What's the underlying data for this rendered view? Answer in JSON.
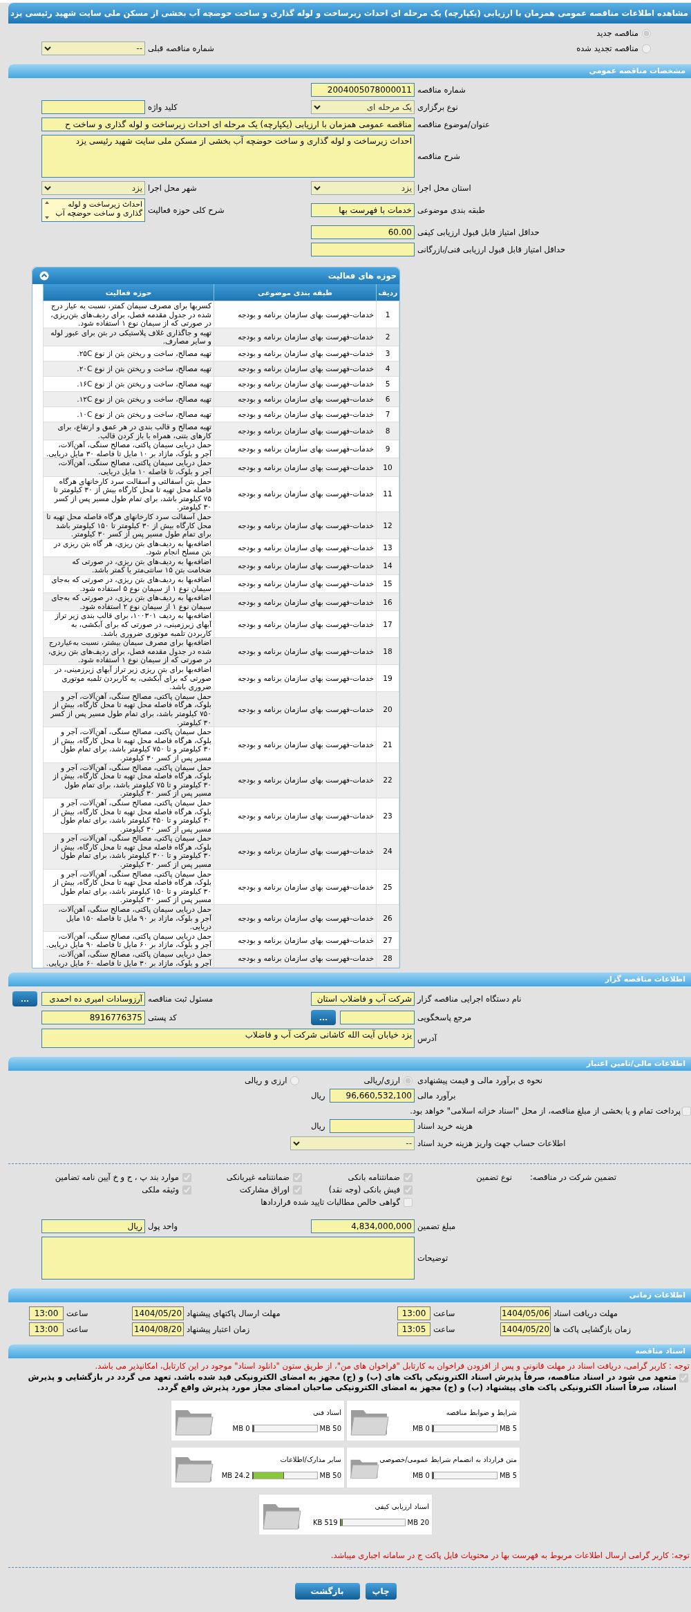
{
  "page_title": "مشاهده اطلاعات مناقصه عمومی همزمان با ارزیابی (یکپارچه) یک مرحله ای احداث زیرساخت و لوله گذاری و ساخت حوضچه آب بخشی از مسکن ملی سایت شهید رئیسی یزد",
  "tender_type": {
    "options": [
      {
        "label": "مناقصه جدید",
        "selected": true
      },
      {
        "label": "مناقصه تجدید شده",
        "selected": false
      }
    ],
    "previous": {
      "label": "شماره مناقصه قبلی",
      "value": "--"
    }
  },
  "general": {
    "title": "مشخصات مناقصه عمومی",
    "rows": [
      [
        {
          "label": "شماره مناقصه",
          "value": "2004005078000011",
          "kind": "input"
        }
      ],
      [
        {
          "label": "نوع برگزاری",
          "value": "یک مرحله ای",
          "kind": "select"
        },
        {
          "label": "کلید واژه",
          "kind": "input"
        }
      ],
      [
        {
          "label": "عنوان/موضوع مناقصه",
          "value": "مناقصه عمومی همزمان با ارزیابی (یکپارچه) یک مرحله ای احداث زیرساخت و لوله گذاری و ساخت ح",
          "kind": "wide-input"
        }
      ],
      [
        {
          "label": "شرح مناقصه",
          "value": "احداث زیرساخت و لوله گذاری و ساخت حوضچه آب بخشی از مسکن ملی سایت شهید رئیسی یزد",
          "kind": "textarea"
        }
      ],
      [
        {
          "label": "استان محل اجرا",
          "value": "یزد",
          "kind": "select"
        },
        {
          "label": "شهر محل اجرا",
          "value": "یزد",
          "kind": "select"
        }
      ],
      [
        {
          "label": "طبقه بندی موضوعی",
          "value": "خدمات با فهرست بها",
          "kind": "input"
        },
        {
          "label": "شرح کلی حوزه فعالیت",
          "value": "احداث زیرساخت و لوله گذاری و ساخت حوضچه آب",
          "kind": "listbox"
        }
      ],
      [
        {
          "label": "حداقل امتیاز قابل قبول ارزیابی کیفی",
          "value": "60.00",
          "kind": "input"
        }
      ],
      [
        {
          "label": "حداقل امتیاز قابل قبول ارزیابی فنی/بازرگانی",
          "kind": "input"
        }
      ]
    ]
  },
  "activities": {
    "title": "حوزه های فعالیت",
    "columns": [
      "ردیف",
      "طبقه بندی موضوعی",
      "حوزه فعالیت"
    ],
    "rows": [
      {
        "index": "1",
        "category": "خدمات-فهرست بهای سازمان برنامه و بودجه",
        "activity": "کسربها برای مصرف سیمان کمتر، نسبت به عیار درج شده در جدول مقدمه فصل، برای ردیف‌های بتن‌ریزی، در صورتی که از سیمان نوع ۱ استفاده شود."
      },
      {
        "index": "2",
        "category": "خدمات-فهرست بهای سازمان برنامه و بودجه",
        "activity": "تهیه و جاگذاری غلاف پلاستیکی در بتن برای عبور لوله و سایر مصارف."
      },
      {
        "index": "3",
        "category": "خدمات-فهرست بهای سازمان برنامه و بودجه",
        "activity": "تهیه مصالح، ساخت و ریختن بتن از نوع ۲۵C."
      },
      {
        "index": "4",
        "category": "خدمات-فهرست بهای سازمان برنامه و بودجه",
        "activity": "تهیه مصالح، ساخت و ریختن بتن از نوع ۲۰C."
      },
      {
        "index": "5",
        "category": "خدمات-فهرست بهای سازمان برنامه و بودجه",
        "activity": "تهیه مصالح، ساخت و ریختن بتن از نوع ۱۶C."
      },
      {
        "index": "6",
        "category": "خدمات-فهرست بهای سازمان برنامه و بودجه",
        "activity": "تهیه مصالح، ساخت و ریختن بتن از نوع ۱۲C."
      },
      {
        "index": "7",
        "category": "خدمات-فهرست بهای سازمان برنامه و بودجه",
        "activity": "تهیه مصالح، ساخت و ریختن بتن از نوع ۱۰C."
      },
      {
        "index": "8",
        "category": "خدمات-فهرست بهای سازمان برنامه و بودجه",
        "activity": "تهیه مصالح و قالب بندی در هر عمق و ارتفاع، برای کارهای بتنی، همراه با باز کردن قالب."
      },
      {
        "index": "9",
        "category": "خدمات-فهرست بهای سازمان برنامه و بودجه",
        "activity": "حمل دریایی سیمان پاکتی، مصالح سنگی، آهن‌آلات، آجر و بلوک، مازاد بر ۱۰ مایل تا فاصله ۳۰ مایل دریایی."
      },
      {
        "index": "10",
        "category": "خدمات-فهرست بهای سازمان برنامه و بودجه",
        "activity": "حمل دریایی سیمان پاکتی، مصالح سنگی، آهن‌آلات، آجر و بلوک، تا فاصله ۱۰ مایل دریایی."
      },
      {
        "index": "11",
        "category": "خدمات-فهرست بهای سازمان برنامه و بودجه",
        "activity": "حمل بتن آسفالتی و آسفالت سرد کارخانهای هرگاه فاصله محل تهیه تا محل کارگاه بیش از ۳۰ کیلومتر تا ۷۵ کیلومتر باشد، برای تمام طول مسیر پس از کسر ۳۰ کیلومتر."
      },
      {
        "index": "12",
        "category": "خدمات-فهرست بهای سازمان برنامه و بودجه",
        "activity": "حمل آسفالت سرد کارخانهای هرگاه فاصله محل تهیه تا محل کارگاه بیش از ۳۰ کیلومتر تا ۱۵۰ کیلومتر باشد برای تمام طول مسیر پس از کسر ۳۰ کیلومتر."
      },
      {
        "index": "13",
        "category": "خدمات-فهرست بهای سازمان برنامه و بودجه",
        "activity": "اضافه‌بها به ردیف‌های بتن ریزی، هر گاه بتن ریزی در بتن مسلح انجام شود."
      },
      {
        "index": "14",
        "category": "خدمات-فهرست بهای سازمان برنامه و بودجه",
        "activity": "اضافه‌بها به ردیف‌های بتن ریزی، در صورتی که ضخامت بتن ۱۵ سانتی‌متر یا کمتر باشد."
      },
      {
        "index": "15",
        "category": "خدمات-فهرست بهای سازمان برنامه و بودجه",
        "activity": "اضافه‌بها به ردیف‌های بتن ریزی، در صورتی که به‌جای سیمان نوع ۱ از سیمان نوع ۵ استفاده شود."
      },
      {
        "index": "16",
        "category": "خدمات-فهرست بهای سازمان برنامه و بودجه",
        "activity": "اضافه‌بها به ردیف‌های بتن ریزی، در صورتی که به‌جای سیمان نوع ۱ از سیمان نوع ۲ استفاده شود."
      },
      {
        "index": "17",
        "category": "خدمات-فهرست بهای سازمان برنامه و بودجه",
        "activity": "اضافه‌بها به ردیف ۱۰۰۳۰۱، برای قالب بندی زیر تراز آبهای زیرزمینی، در صورتی که برای آبکشی، به کاربردن تلمبه موتوری ضروری باشد."
      },
      {
        "index": "18",
        "category": "خدمات-فهرست بهای سازمان برنامه و بودجه",
        "activity": "اضافه‌بها برای مصرف سیمان بیشتر، نسبت به‌عیاردرج شده در جدول مقدمه فصل، برای ردیف‌های بتن ریزی، در صورتی که از سیمان نوع ۱ استفاده شود."
      },
      {
        "index": "19",
        "category": "خدمات-فهرست بهای سازمان برنامه و بودجه",
        "activity": "اضافه‌بها برای بتن ریزی زیر تراز آبهای زیرزمینی، در صورتی که برای آبکشی، به کاربردن تلمبه موتوری ضروری باشد."
      },
      {
        "index": "20",
        "category": "خدمات-فهرست بهای سازمان برنامه و بودجه",
        "activity": "حمل سیمان پاکتی، مصالح سنگی، آهن‌آلات، آجر و بلوک، هرگاه فاصله محل تهیه تا محل کارگاه، بیش از ۷۵۰ کیلومتر باشد، برای تمام طول مسیر پس از کسر ۳۰ کیلومتر."
      },
      {
        "index": "21",
        "category": "خدمات-فهرست بهای سازمان برنامه و بودجه",
        "activity": "حمل سیمان پاکتی، مصالح سنگی، آهن‌آلات، آجر و بلوک، هرگاه فاصله محل تهیه تا محل کارگاه، بیش از ۳۰ کیلومتر و تا ۷۵۰ کیلومتر باشد، برای تمام طول مسیر پس از کسر ۳۰ کیلومتر."
      },
      {
        "index": "22",
        "category": "خدمات-فهرست بهای سازمان برنامه و بودجه",
        "activity": "حمل سیمان پاکتی، مصالح سنگی، آهن‌آلات، آجر و بلوک، هرگاه فاصله محل تهیه تا محل کارگاه، بیش از ۳۰ کیلومتر و تا ۷۵ کیلومتر باشد، برای تمام طول مسیر پس از کسر ۳۰ کیلومتر."
      },
      {
        "index": "23",
        "category": "خدمات-فهرست بهای سازمان برنامه و بودجه",
        "activity": "حمل سیمان پاکتی، مصالح سنگی، آهن‌آلات، آجر و بلوک، هرگاه فاصله محل تهیه تا محل کارگاه، بیش از ۳۰ کیلومتر و تا ۴۵۰ کیلومتر باشد، برای تمام طول مسیر پس از کسر ۳۰ کیلومتر."
      },
      {
        "index": "24",
        "category": "خدمات-فهرست بهای سازمان برنامه و بودجه",
        "activity": "حمل سیمان پاکتی، مصالح سنگی، آهن‌آلات، آجر و بلوک، هرگاه فاصله محل تهیه تا محل کارگاه، بیش از ۳۰ کیلومتر و تا ۳۰۰ کیلومتر باشد، برای تمام طول مسیر پس از کسر ۳۰ کیلومتر."
      },
      {
        "index": "25",
        "category": "خدمات-فهرست بهای سازمان برنامه و بودجه",
        "activity": "حمل سیمان پاکتی، مصالح سنگی، آهن‌آلات، آجر و بلوک، هرگاه فاصله محل تهیه تا محل کارگاه، بیش از ۳۰ کیلومتر و تا ۱۵۰ کیلومتر باشد، برای تمام طول مسیر پس از کسر ۳۰ کیلومتر."
      },
      {
        "index": "26",
        "category": "خدمات-فهرست بهای سازمان برنامه و بودجه",
        "activity": "حمل دریایی سیمان پاکتی، مصالح سنگی، آهن‌آلات، آجر و بلوک، مازاد بر ۹۰ مایل تا فاصله ۱۵۰ مایل دریایی."
      },
      {
        "index": "27",
        "category": "خدمات-فهرست بهای سازمان برنامه و بودجه",
        "activity": "حمل دریایی سیمان پاکتی، مصالح سنگی، آهن‌آلات، آجر و بلوک، مازاد بر ۶۰ مایل تا فاصله ۹۰ مایل دریایی."
      },
      {
        "index": "28",
        "category": "خدمات-فهرست بهای سازمان برنامه و بودجه",
        "activity": "حمل دریایی سیمان پاکتی، مصالح سنگی، آهن‌آلات، آجر و بلوک، مازاد بر ۳۰ مایل تا فاصله ۶۰ مایل دریایی."
      }
    ]
  },
  "organizer": {
    "title": "اطلاعات مناقصه گزار",
    "rows": [
      [
        {
          "label": "نام دستگاه اجرایی مناقصه گزار",
          "value": "شرکت آب و فاضلاب استان",
          "kind": "input"
        },
        {
          "label": "مسئول ثبت مناقصه",
          "value": "آرزوسادات امیری ده احمدی",
          "kind": "input",
          "button": "..."
        }
      ],
      [
        {
          "label": "مرجع پاسخگویی",
          "kind": "input",
          "button": "..."
        },
        {
          "label": "کد پستی",
          "value": "8916776375",
          "kind": "input"
        }
      ],
      [
        {
          "label": "آدرس",
          "value": "یزد خیابان آیت الله کاشانی شرکت آب و فاضلاب",
          "kind": "short-textarea"
        }
      ]
    ]
  },
  "financial": {
    "title": "اطلاعات مالی/تامین اعتبار",
    "estimate_method": {
      "label": "نحوه ی برآورد مالی و قیمت پیشنهادی",
      "options": [
        {
          "label": "ارزی/ریالی",
          "selected": true
        },
        {
          "label": "ارزی و ریالی",
          "selected": false
        }
      ]
    },
    "estimate": {
      "label": "برآورد مالی",
      "value": "96,660,532,100",
      "unit": "ریال"
    },
    "treasury": {
      "label": "پرداخت تمام و یا بخشی از مبلغ مناقصه، از محل \"اسناد خزانه اسلامی\" خواهد بود.",
      "checked": false
    },
    "document_fee": {
      "label": "هزینه خرید اسناد",
      "unit": "ریال"
    },
    "account": {
      "label": "اطلاعات حساب جهت واریز هزینه خرید اسناد",
      "value": "--"
    },
    "guarantee": {
      "label": "تضمین شرکت در مناقصه:",
      "type_label": "نوع تضمین",
      "options": [
        {
          "label": "ضمانتنامه بانکی",
          "checked": true
        },
        {
          "label": "ضمانتنامه غیربانکی",
          "checked": true
        },
        {
          "label": "موارد بند پ ، ح و خ آیین نامه تضامین",
          "checked": true
        },
        {
          "label": "فیش بانکی (وجه نقد)",
          "checked": true
        },
        {
          "label": "اوراق مشارکت",
          "checked": true
        },
        {
          "label": "وثیقه ملکی",
          "checked": true
        },
        {
          "label": "گواهی خالص مطالبات تایید شده قراردادها",
          "checked": false
        }
      ]
    },
    "amount": {
      "label": "مبلغ تضمین",
      "value": "4,834,000,000"
    },
    "currency": {
      "label": "واحد پول",
      "value": "ریال"
    },
    "notes": {
      "label": "توضیحات"
    }
  },
  "schedule": {
    "title": "اطلاعات زمانی",
    "rows": [
      [
        {
          "label": "مهلت دریافت اسناد",
          "date": "1404/05/06",
          "time_label": "ساعت",
          "time": "13:00"
        },
        {
          "label": "مهلت ارسال پاکتهای پیشنهاد",
          "date": "1404/05/20",
          "time_label": "ساعت",
          "time": "13:00"
        }
      ],
      [
        {
          "label": "زمان بازگشایی پاکت ها",
          "date": "1404/05/20",
          "time_label": "ساعت",
          "time": "13:05"
        },
        {
          "label": "زمان اعتبار پیشنهاد",
          "date": "1404/08/20",
          "time_label": "ساعت",
          "time": "13:00"
        }
      ]
    ]
  },
  "documents": {
    "title": "اسناد مناقصه",
    "notice": "توجه : کاربر گرامی، دریافت اسناد در مهلت قانونی و پس از افزودن فراخوان به کارتابل \"فراخوان های من\"، از طریق ستون \"دانلود اسناد\" موجود در این کارتابل، امکانپذیر می باشد.",
    "commitment": {
      "text": "متعهد می شود در اسناد مناقصه، صرفاً پذیرش اسناد الکترونیکی پاکت های (ب) و (ج) مجهز به امضای الکترونیکی قید شده باشد. تعهد می گردد در بازگشایی و پذیرش اسناد، صرفاً اسناد الکترونیکی پاکت های پیشنهاد (ب) و (ج) مجهز به امضای الکترونیکی صاحبان امضای مجاز مورد پذیرش واقع گردد.",
      "checked": true
    },
    "files": [
      {
        "title": "شرایط و ضوابط مناقصه",
        "used": "0 MB",
        "max": "5 MB",
        "level": 0
      },
      {
        "title": "اسناد فنی",
        "used": "0 MB",
        "max": "50 MB",
        "level": 0
      },
      {
        "title": "متن قرارداد به انضمام شرایط عمومی/خصوصی",
        "used": "0 MB",
        "max": "5 MB",
        "level": 0
      },
      {
        "title": "سایر مدارک/اطلاعات",
        "used": "24.2 MB",
        "max": "50 MB",
        "level": 0.484
      },
      {
        "title": "اسناد ارزیابی کیفی",
        "used": "519 KB",
        "max": "20 MB",
        "level": 0.025
      }
    ],
    "note": "توجه: کاربر گرامی ارسال اطلاعات مربوط به فهرست بها در محتویات فایل پاکت ج در سامانه اجباری میباشد."
  },
  "buttons": [
    {
      "label": "چاپ"
    },
    {
      "label": "بازگشت"
    }
  ]
}
